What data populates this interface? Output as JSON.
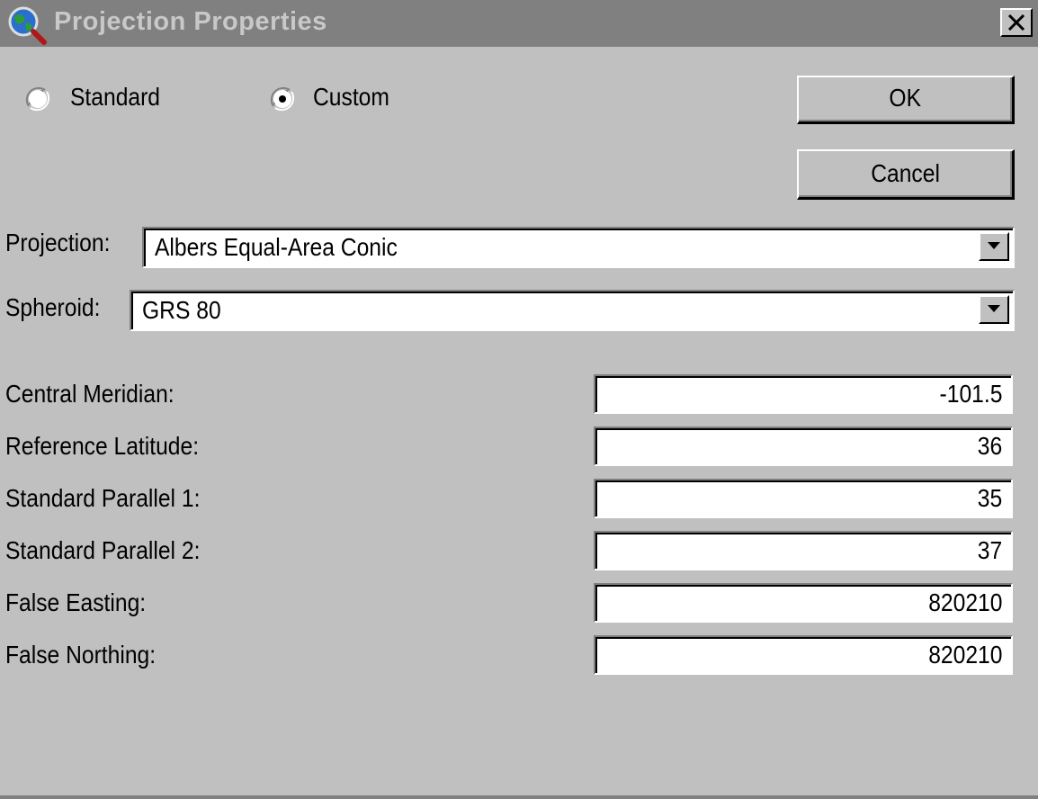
{
  "window": {
    "title": "Projection Properties",
    "app_icon": "globe-magnifier-icon",
    "close_icon": "close-icon"
  },
  "mode": {
    "options": [
      {
        "label": "Standard",
        "selected": false
      },
      {
        "label": "Custom",
        "selected": true
      }
    ]
  },
  "buttons": {
    "ok_label": "OK",
    "cancel_label": "Cancel"
  },
  "projection": {
    "label": "Projection:",
    "value": "Albers Equal-Area Conic"
  },
  "spheroid": {
    "label": "Spheroid:",
    "value": "GRS 80"
  },
  "parameters": [
    {
      "label": "Central Meridian:",
      "value": "-101.5"
    },
    {
      "label": "Reference Latitude:",
      "value": "36"
    },
    {
      "label": "Standard Parallel 1:",
      "value": "35"
    },
    {
      "label": "Standard Parallel 2:",
      "value": "37"
    },
    {
      "label": "False Easting:",
      "value": "820210"
    },
    {
      "label": "False Northing:",
      "value": "820210"
    }
  ],
  "colors": {
    "dialog_background": "#c0c0c0",
    "titlebar_inactive": "#808080",
    "titlebar_text": "#c8c8c8",
    "field_background": "#ffffff"
  }
}
